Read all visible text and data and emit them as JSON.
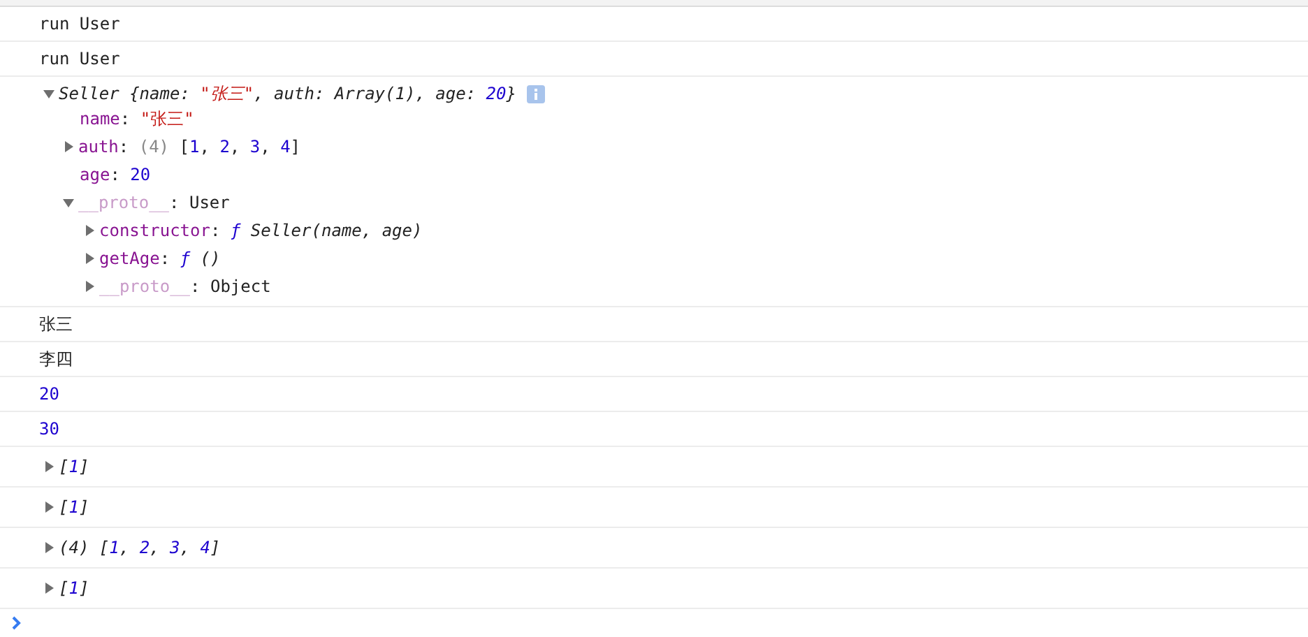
{
  "messages": [
    {
      "tokens": [
        {
          "text": "run User",
          "kind": "plain"
        }
      ]
    },
    {
      "tokens": [
        {
          "text": "run User",
          "kind": "plain"
        }
      ]
    },
    {
      "expanded": true,
      "tokens": [
        {
          "text": "Seller {name: ",
          "kind": "plain",
          "italic": true
        },
        {
          "text": "\"张三\"",
          "kind": "string",
          "italic": true
        },
        {
          "text": ", auth: Array(1), age: ",
          "kind": "plain",
          "italic": true
        },
        {
          "text": "20",
          "kind": "number",
          "italic": true
        },
        {
          "text": "}",
          "kind": "plain",
          "italic": true
        }
      ],
      "info": true,
      "children": [
        {
          "tokens": [
            {
              "text": "name",
              "kind": "key"
            },
            {
              "text": ": ",
              "kind": "plain"
            },
            {
              "text": "\"张三\"",
              "kind": "string"
            }
          ]
        },
        {
          "expanded": false,
          "tokens": [
            {
              "text": "auth",
              "kind": "key"
            },
            {
              "text": ": ",
              "kind": "plain"
            },
            {
              "text": "(4) ",
              "kind": "muted"
            },
            {
              "text": "[",
              "kind": "plain"
            },
            {
              "text": "1",
              "kind": "number"
            },
            {
              "text": ", ",
              "kind": "plain"
            },
            {
              "text": "2",
              "kind": "number"
            },
            {
              "text": ", ",
              "kind": "plain"
            },
            {
              "text": "3",
              "kind": "number"
            },
            {
              "text": ", ",
              "kind": "plain"
            },
            {
              "text": "4",
              "kind": "number"
            },
            {
              "text": "]",
              "kind": "plain"
            }
          ]
        },
        {
          "tokens": [
            {
              "text": "age",
              "kind": "key"
            },
            {
              "text": ": ",
              "kind": "plain"
            },
            {
              "text": "20",
              "kind": "number"
            }
          ]
        },
        {
          "expanded": true,
          "tokens": [
            {
              "text": "__proto__",
              "kind": "dim-key"
            },
            {
              "text": ": User",
              "kind": "plain"
            }
          ],
          "children": [
            {
              "expanded": false,
              "tokens": [
                {
                  "text": "constructor",
                  "kind": "key"
                },
                {
                  "text": ": ",
                  "kind": "plain"
                },
                {
                  "text": "ƒ",
                  "kind": "number",
                  "italic": true
                },
                {
                  "text": " Seller(name, age)",
                  "kind": "plain",
                  "italic": true
                }
              ]
            },
            {
              "expanded": false,
              "tokens": [
                {
                  "text": "getAge",
                  "kind": "key"
                },
                {
                  "text": ": ",
                  "kind": "plain"
                },
                {
                  "text": "ƒ",
                  "kind": "number",
                  "italic": true
                },
                {
                  "text": " ()",
                  "kind": "plain",
                  "italic": true
                }
              ]
            },
            {
              "expanded": false,
              "tokens": [
                {
                  "text": "__proto__",
                  "kind": "dim-key"
                },
                {
                  "text": ": Object",
                  "kind": "plain"
                }
              ]
            }
          ]
        }
      ]
    },
    {
      "tokens": [
        {
          "text": "张三",
          "kind": "plain"
        }
      ]
    },
    {
      "tokens": [
        {
          "text": "李四",
          "kind": "plain"
        }
      ]
    },
    {
      "tokens": [
        {
          "text": "20",
          "kind": "number"
        }
      ]
    },
    {
      "tokens": [
        {
          "text": "30",
          "kind": "number"
        }
      ]
    },
    {
      "expanded": false,
      "tokens": [
        {
          "text": "[",
          "kind": "plain",
          "italic": true
        },
        {
          "text": "1",
          "kind": "number",
          "italic": true
        },
        {
          "text": "]",
          "kind": "plain",
          "italic": true
        }
      ]
    },
    {
      "expanded": false,
      "tokens": [
        {
          "text": "[",
          "kind": "plain",
          "italic": true
        },
        {
          "text": "1",
          "kind": "number",
          "italic": true
        },
        {
          "text": "]",
          "kind": "plain",
          "italic": true
        }
      ]
    },
    {
      "expanded": false,
      "tokens": [
        {
          "text": "(4) [",
          "kind": "plain",
          "italic": true
        },
        {
          "text": "1",
          "kind": "number",
          "italic": true
        },
        {
          "text": ", ",
          "kind": "plain",
          "italic": true
        },
        {
          "text": "2",
          "kind": "number",
          "italic": true
        },
        {
          "text": ", ",
          "kind": "plain",
          "italic": true
        },
        {
          "text": "3",
          "kind": "number",
          "italic": true
        },
        {
          "text": ", ",
          "kind": "plain",
          "italic": true
        },
        {
          "text": "4",
          "kind": "number",
          "italic": true
        },
        {
          "text": "]",
          "kind": "plain",
          "italic": true
        }
      ]
    },
    {
      "expanded": false,
      "tokens": [
        {
          "text": "[",
          "kind": "plain",
          "italic": true
        },
        {
          "text": "1",
          "kind": "number",
          "italic": true
        },
        {
          "text": "]",
          "kind": "plain",
          "italic": true
        }
      ]
    }
  ]
}
